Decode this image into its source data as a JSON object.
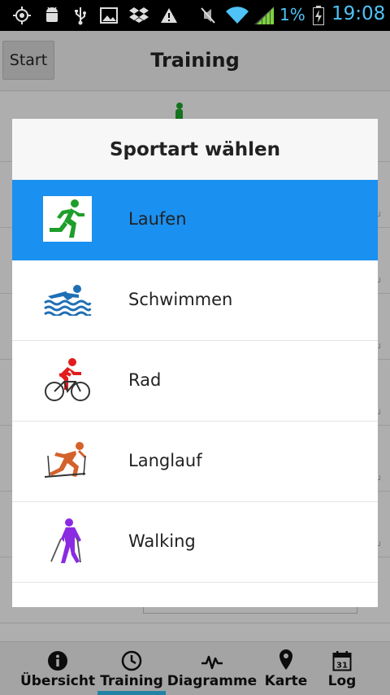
{
  "status_bar": {
    "battery_percent": "1%",
    "time": "19:08",
    "icons": [
      "gps-icon",
      "android-debug-icon",
      "usb-icon",
      "image-icon",
      "dropbox-icon",
      "warning-icon",
      "mute-icon",
      "wifi-icon",
      "signal-icon",
      "battery-icon"
    ],
    "accent_color": "#4fc3f7"
  },
  "app": {
    "start_button": "Start",
    "title": "Training"
  },
  "dialog": {
    "title": "Sportart wählen",
    "selected_color": "#1a90f0",
    "items": [
      {
        "label": "Laufen",
        "icon": "running-icon",
        "color": "#1e9e2a",
        "selected": true
      },
      {
        "label": "Schwimmen",
        "icon": "swimming-icon",
        "color": "#1f6fb5",
        "selected": false
      },
      {
        "label": "Rad",
        "icon": "cycling-icon",
        "color": "#e21c1c",
        "selected": false
      },
      {
        "label": "Langlauf",
        "icon": "cross-country-skiing-icon",
        "color": "#d4622b",
        "selected": false
      },
      {
        "label": "Walking",
        "icon": "nordic-walking-icon",
        "color": "#8a2be2",
        "selected": false
      }
    ]
  },
  "tabs": [
    {
      "label": "Übersicht",
      "icon": "info-icon",
      "active": false
    },
    {
      "label": "Training",
      "icon": "clock-icon",
      "active": true
    },
    {
      "label": "Diagramme",
      "icon": "pulse-icon",
      "active": false
    },
    {
      "label": "Karte",
      "icon": "map-pin-icon",
      "active": false
    },
    {
      "label": "Log",
      "icon": "calendar-icon",
      "active": false
    }
  ],
  "calendar_day": "31",
  "tab_indicator_color": "#33b5e5"
}
